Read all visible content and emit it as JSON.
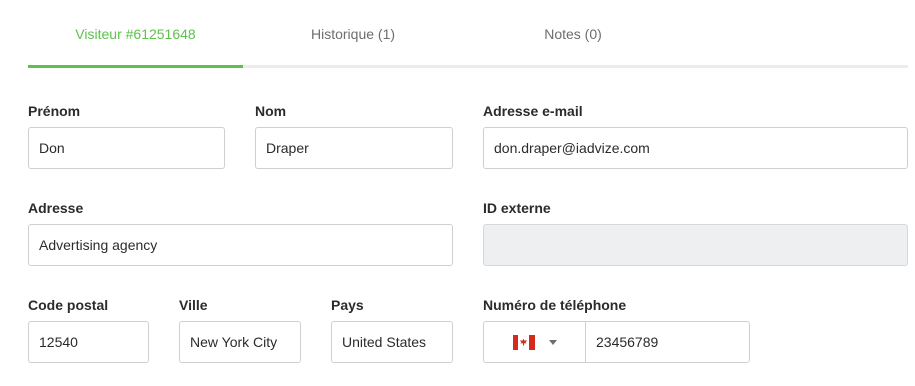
{
  "tabs": [
    {
      "label": "Visiteur #61251648",
      "active": true
    },
    {
      "label": "Historique (1)",
      "active": false
    },
    {
      "label": "Notes (0)",
      "active": false
    }
  ],
  "form": {
    "prenom": {
      "label": "Prénom",
      "value": "Don"
    },
    "nom": {
      "label": "Nom",
      "value": "Draper"
    },
    "email": {
      "label": "Adresse e-mail",
      "value": "don.draper@iadvize.com"
    },
    "adresse": {
      "label": "Adresse",
      "value": "Advertising agency"
    },
    "id_externe": {
      "label": "ID externe",
      "value": ""
    },
    "code_postal": {
      "label": "Code postal",
      "value": "12540"
    },
    "ville": {
      "label": "Ville",
      "value": "New York City"
    },
    "pays": {
      "label": "Pays",
      "value": "United States"
    },
    "telephone": {
      "label": "Numéro de téléphone",
      "country_icon": "canada-flag-icon",
      "value": "23456789"
    }
  },
  "colors": {
    "accent": "#5cc24a",
    "tab_inactive": "#6e6e6e",
    "disabled_bg": "#eeeff0"
  }
}
